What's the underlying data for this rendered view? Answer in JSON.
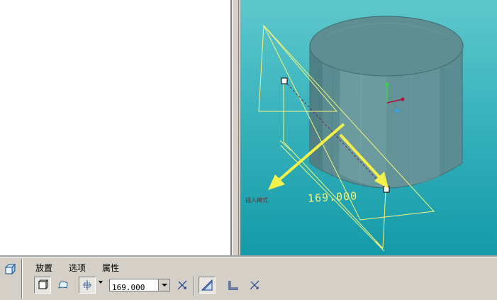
{
  "tabs": [
    {
      "label": "放置"
    },
    {
      "label": "选项"
    },
    {
      "label": "属性"
    }
  ],
  "depth": {
    "value": "169.000",
    "options": [
      "169.000"
    ]
  },
  "viewport": {
    "dimension_label": "169.000",
    "annotation": "插入模式"
  },
  "icons": {
    "left_tool": "extrude-feature-icon",
    "solid": "solid-icon",
    "surface": "surface-icon",
    "depth_option": "blind-depth-icon",
    "flip": "flip-direction-icon",
    "remove_material": "remove-material-icon",
    "thicken": "thicken-icon",
    "flip_thicken": "flip-thicken-icon"
  },
  "colors": {
    "viewport_top": "#5ec8cc",
    "viewport_bottom": "#149aa8",
    "sketch_line": "#f5f57a",
    "arrow": "#f2f24a"
  }
}
